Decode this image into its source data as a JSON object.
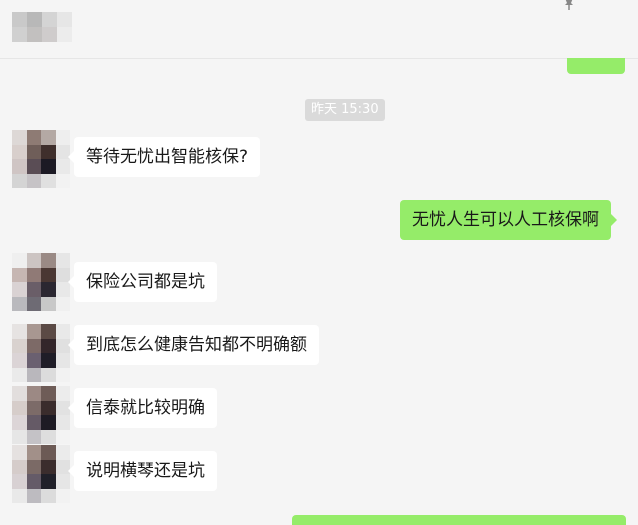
{
  "chat": {
    "timestamp": "昨天 15:30",
    "messages": [
      {
        "direction": "incoming",
        "text": "等待无忧出智能核保?"
      },
      {
        "direction": "outgoing",
        "text": "无忧人生可以人工核保啊"
      },
      {
        "direction": "incoming",
        "text": "保险公司都是坑"
      },
      {
        "direction": "incoming",
        "text": "到底怎么健康告知都不明确额"
      },
      {
        "direction": "incoming",
        "text": "信泰就比较明确"
      },
      {
        "direction": "incoming",
        "text": "说明横琴还是坑"
      }
    ]
  },
  "colors": {
    "background": "#f5f5f5",
    "incoming_bubble": "#ffffff",
    "outgoing_bubble": "#95ec69",
    "timestamp_bg": "#dadada"
  }
}
